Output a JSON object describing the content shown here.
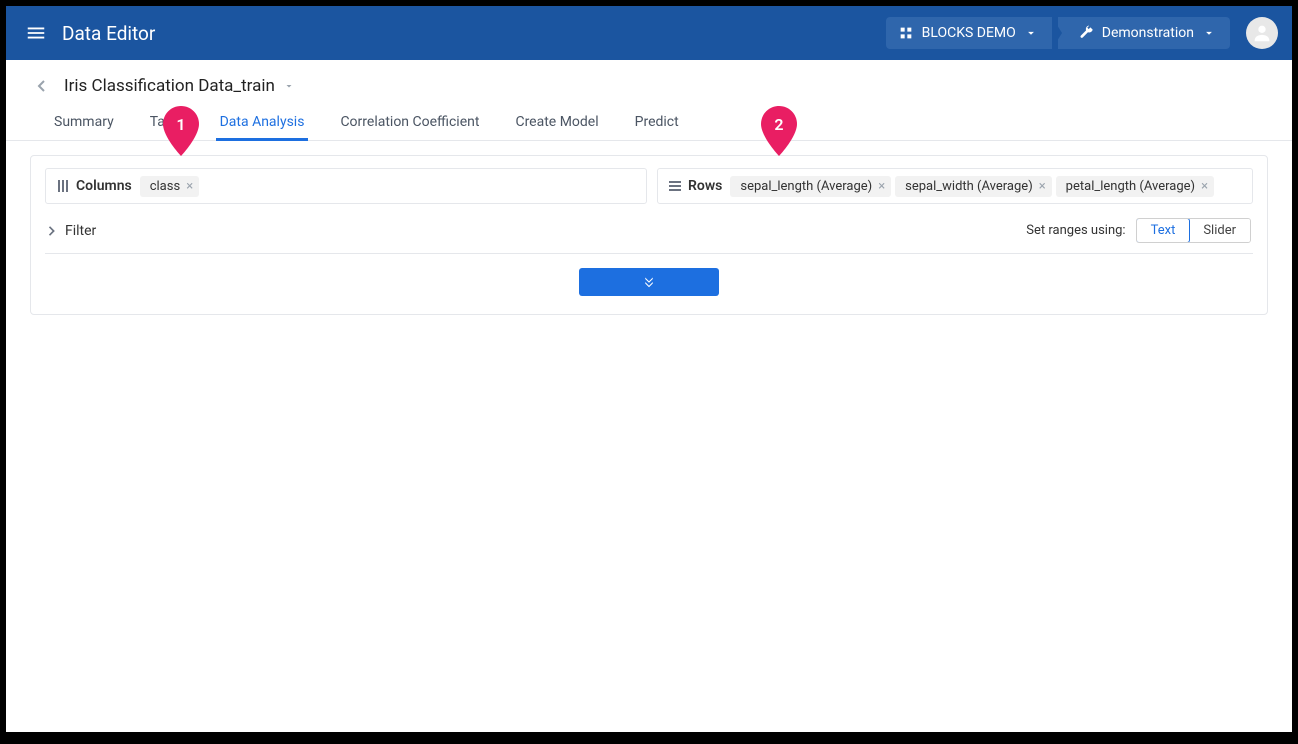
{
  "header": {
    "app_title": "Data Editor",
    "breadcrumb": {
      "org": "BLOCKS DEMO",
      "project": "Demonstration"
    }
  },
  "page": {
    "back_visible": true,
    "title": "Iris Classification Data_train"
  },
  "tabs": [
    {
      "id": "summary",
      "label": "Summary",
      "active": false
    },
    {
      "id": "table",
      "label": "Table",
      "active": false
    },
    {
      "id": "data-analysis",
      "label": "Data Analysis",
      "active": true
    },
    {
      "id": "correlation",
      "label": "Correlation Coefficient",
      "active": false
    },
    {
      "id": "create-model",
      "label": "Create Model",
      "active": false
    },
    {
      "id": "predict",
      "label": "Predict",
      "active": false
    }
  ],
  "shelves": {
    "columns": {
      "label": "Columns",
      "chips": [
        {
          "label": "class"
        }
      ]
    },
    "rows": {
      "label": "Rows",
      "chips": [
        {
          "label": "sepal_length (Average)"
        },
        {
          "label": "sepal_width (Average)"
        },
        {
          "label": "petal_length (Average)"
        }
      ]
    }
  },
  "filter": {
    "label": "Filter",
    "ranges_label": "Set ranges using:",
    "options": {
      "text": "Text",
      "slider": "Slider"
    },
    "active": "text"
  },
  "markers": {
    "m1": "1",
    "m2": "2"
  }
}
